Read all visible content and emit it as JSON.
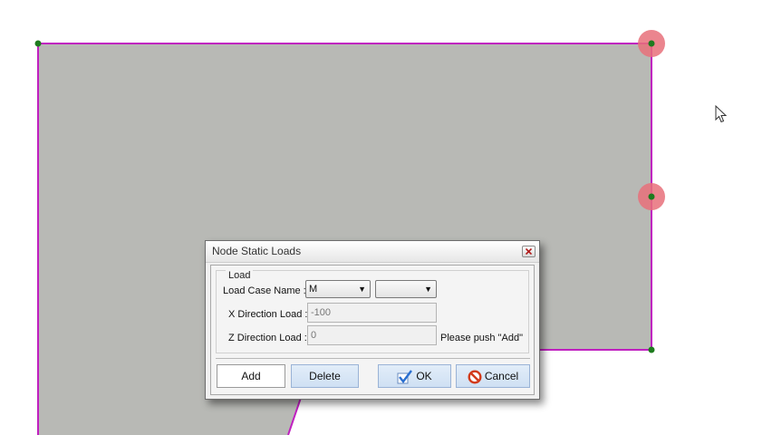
{
  "canvas": {
    "region_fill": "#b8b9b5",
    "edge_color": "#c020c0",
    "node_color": "#1e7b1e",
    "selected_node_color": "#e8707a"
  },
  "dialog": {
    "title": "Node Static Loads",
    "close_icon": "close-icon",
    "group_label": "Load",
    "load_case": {
      "label": "Load Case Name :",
      "selected": "M",
      "secondary_selected": ""
    },
    "x_load": {
      "label": "X Direction Load :",
      "value": "-100"
    },
    "z_load": {
      "label": "Z Direction Load :",
      "value": "0"
    },
    "hint": "Please push \"Add\"",
    "buttons": {
      "add": "Add",
      "delete": "Delete",
      "ok": "OK",
      "cancel": "Cancel"
    }
  }
}
